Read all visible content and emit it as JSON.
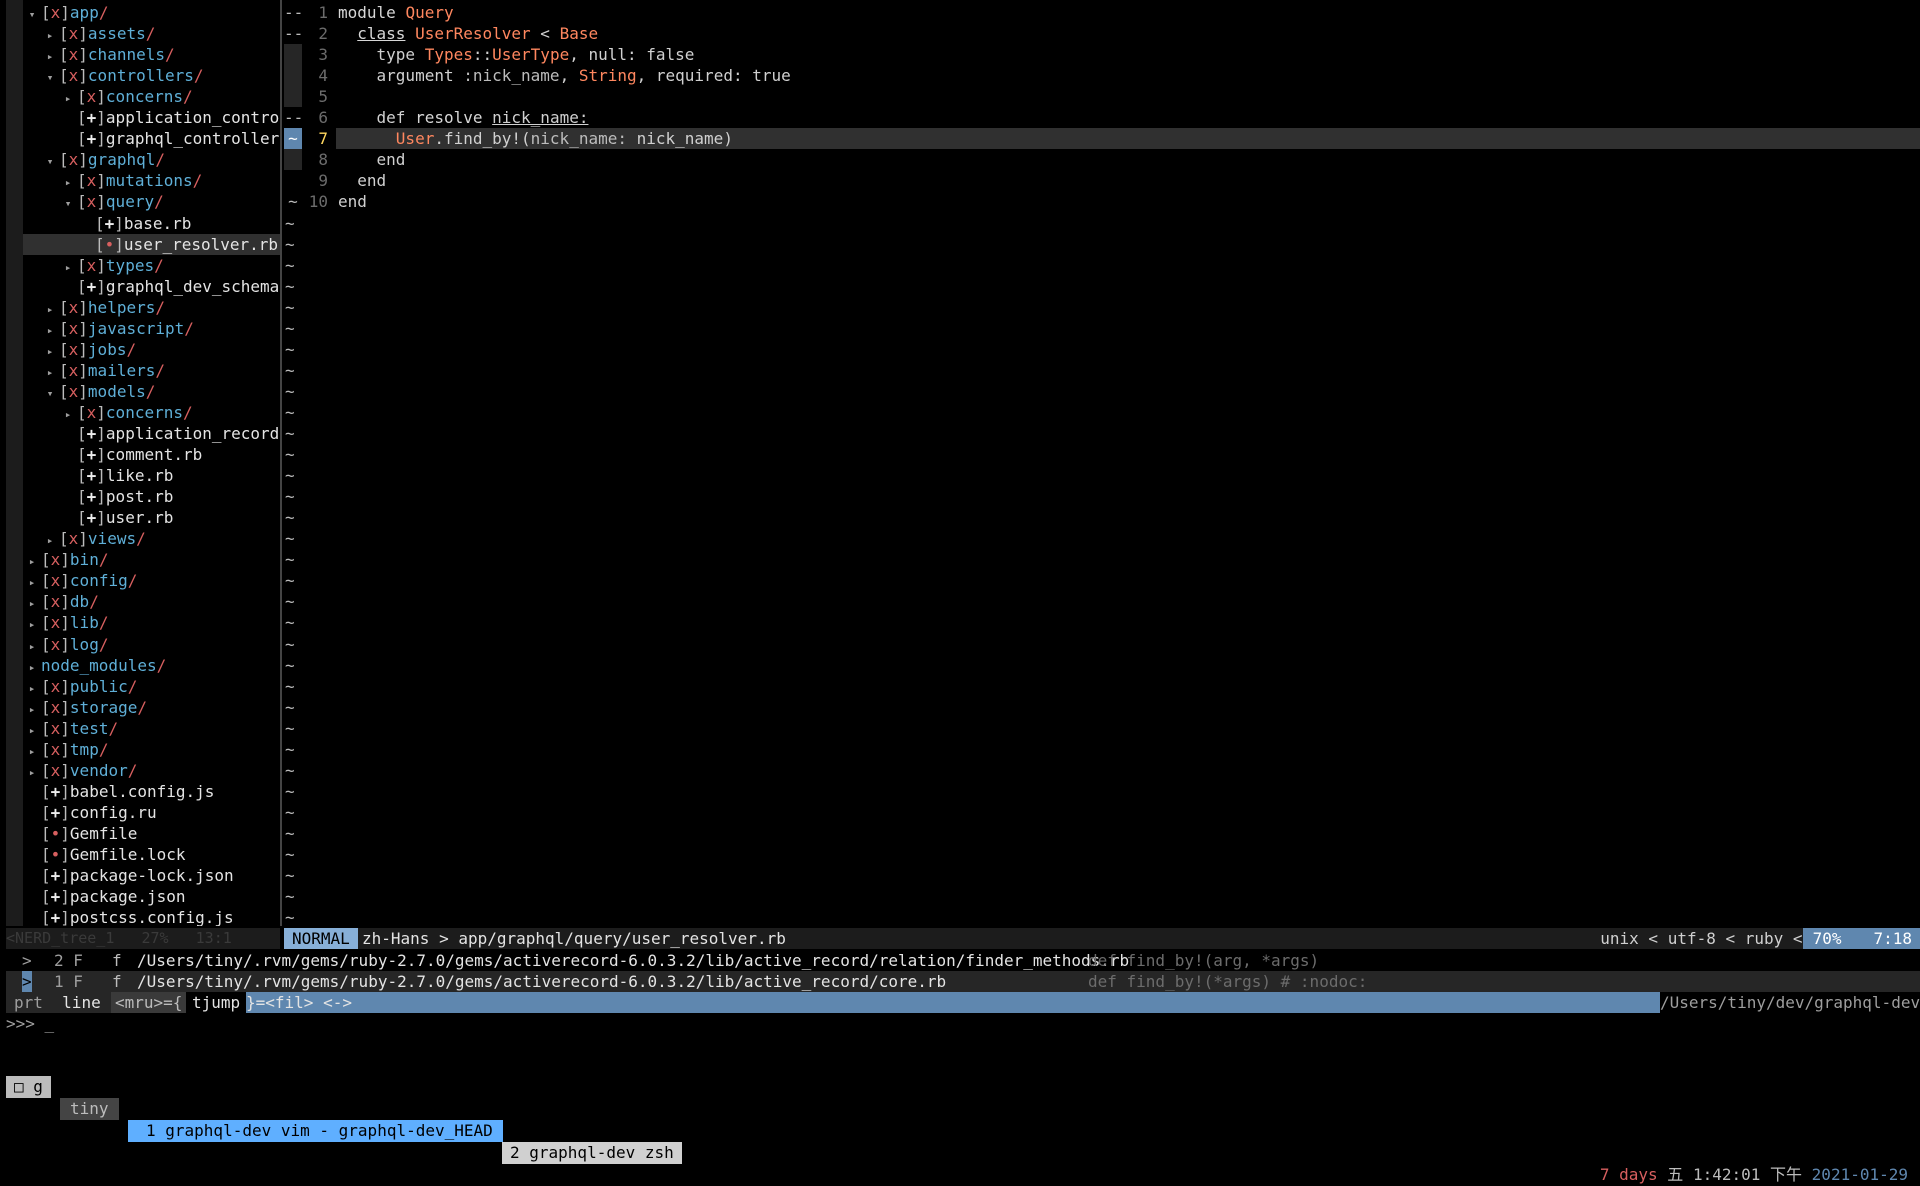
{
  "tree": [
    {
      "depth": 0,
      "arrow": "▾",
      "kind": "dir",
      "mark": "x",
      "name": "app"
    },
    {
      "depth": 1,
      "arrow": "▸",
      "kind": "dir",
      "mark": "x",
      "name": "assets"
    },
    {
      "depth": 1,
      "arrow": "▸",
      "kind": "dir",
      "mark": "x",
      "name": "channels"
    },
    {
      "depth": 1,
      "arrow": "▾",
      "kind": "dir",
      "mark": "x",
      "name": "controllers"
    },
    {
      "depth": 2,
      "arrow": "▸",
      "kind": "dir",
      "mark": "x",
      "name": "concerns"
    },
    {
      "depth": 2,
      "arrow": "",
      "kind": "file",
      "mark": "+",
      "name": "application_control"
    },
    {
      "depth": 2,
      "arrow": "",
      "kind": "file",
      "mark": "+",
      "name": "graphql_controller."
    },
    {
      "depth": 1,
      "arrow": "▾",
      "kind": "dir",
      "mark": "x",
      "name": "graphql"
    },
    {
      "depth": 2,
      "arrow": "▸",
      "kind": "dir",
      "mark": "x",
      "name": "mutations"
    },
    {
      "depth": 2,
      "arrow": "▾",
      "kind": "dir",
      "mark": "x",
      "name": "query"
    },
    {
      "depth": 3,
      "arrow": "",
      "kind": "file",
      "mark": "+",
      "name": "base.rb"
    },
    {
      "depth": 3,
      "arrow": "",
      "kind": "file",
      "mark": "•",
      "name": "user_resolver.rb",
      "selected": true
    },
    {
      "depth": 2,
      "arrow": "▸",
      "kind": "dir",
      "mark": "x",
      "name": "types"
    },
    {
      "depth": 2,
      "arrow": "",
      "kind": "file",
      "mark": "+",
      "name": "graphql_dev_schema."
    },
    {
      "depth": 1,
      "arrow": "▸",
      "kind": "dir",
      "mark": "x",
      "name": "helpers"
    },
    {
      "depth": 1,
      "arrow": "▸",
      "kind": "dir",
      "mark": "x",
      "name": "javascript"
    },
    {
      "depth": 1,
      "arrow": "▸",
      "kind": "dir",
      "mark": "x",
      "name": "jobs"
    },
    {
      "depth": 1,
      "arrow": "▸",
      "kind": "dir",
      "mark": "x",
      "name": "mailers"
    },
    {
      "depth": 1,
      "arrow": "▾",
      "kind": "dir",
      "mark": "x",
      "name": "models"
    },
    {
      "depth": 2,
      "arrow": "▸",
      "kind": "dir",
      "mark": "x",
      "name": "concerns"
    },
    {
      "depth": 2,
      "arrow": "",
      "kind": "file",
      "mark": "+",
      "name": "application_record."
    },
    {
      "depth": 2,
      "arrow": "",
      "kind": "file",
      "mark": "+",
      "name": "comment.rb"
    },
    {
      "depth": 2,
      "arrow": "",
      "kind": "file",
      "mark": "+",
      "name": "like.rb"
    },
    {
      "depth": 2,
      "arrow": "",
      "kind": "file",
      "mark": "+",
      "name": "post.rb"
    },
    {
      "depth": 2,
      "arrow": "",
      "kind": "file",
      "mark": "+",
      "name": "user.rb"
    },
    {
      "depth": 1,
      "arrow": "▸",
      "kind": "dir",
      "mark": "x",
      "name": "views"
    },
    {
      "depth": 0,
      "arrow": "▸",
      "kind": "dir",
      "mark": "x",
      "name": "bin"
    },
    {
      "depth": 0,
      "arrow": "▸",
      "kind": "dir",
      "mark": "x",
      "name": "config"
    },
    {
      "depth": 0,
      "arrow": "▸",
      "kind": "dir",
      "mark": "x",
      "name": "db"
    },
    {
      "depth": 0,
      "arrow": "▸",
      "kind": "dir",
      "mark": "x",
      "name": "lib"
    },
    {
      "depth": 0,
      "arrow": "▸",
      "kind": "dir",
      "mark": "x",
      "name": "log"
    },
    {
      "depth": 0,
      "arrow": "▸",
      "kind": "dir",
      "mark": "",
      "name": "node_modules"
    },
    {
      "depth": 0,
      "arrow": "▸",
      "kind": "dir",
      "mark": "x",
      "name": "public"
    },
    {
      "depth": 0,
      "arrow": "▸",
      "kind": "dir",
      "mark": "x",
      "name": "storage"
    },
    {
      "depth": 0,
      "arrow": "▸",
      "kind": "dir",
      "mark": "x",
      "name": "test"
    },
    {
      "depth": 0,
      "arrow": "▸",
      "kind": "dir",
      "mark": "x",
      "name": "tmp"
    },
    {
      "depth": 0,
      "arrow": "▸",
      "kind": "dir",
      "mark": "x",
      "name": "vendor"
    },
    {
      "depth": 0,
      "arrow": "",
      "kind": "file",
      "mark": "+",
      "name": "babel.config.js"
    },
    {
      "depth": 0,
      "arrow": "",
      "kind": "file",
      "mark": "+",
      "name": "config.ru"
    },
    {
      "depth": 0,
      "arrow": "",
      "kind": "file",
      "mark": "•",
      "name": "Gemfile"
    },
    {
      "depth": 0,
      "arrow": "",
      "kind": "file",
      "mark": "•",
      "name": "Gemfile.lock"
    },
    {
      "depth": 0,
      "arrow": "",
      "kind": "file",
      "mark": "+",
      "name": "package-lock.json"
    },
    {
      "depth": 0,
      "arrow": "",
      "kind": "file",
      "mark": "+",
      "name": "package.json"
    },
    {
      "depth": 0,
      "arrow": "",
      "kind": "file",
      "mark": "+",
      "name": "postcss.config.js"
    }
  ],
  "signs": [
    "--",
    "--",
    "",
    "",
    "",
    "--",
    "~",
    "",
    "",
    "~"
  ],
  "code": [
    [
      {
        "t": "module ",
        "c": "kw ul-first"
      },
      {
        "t": "Query",
        "c": "const"
      }
    ],
    [
      {
        "t": "  "
      },
      {
        "t": "class",
        "c": "kw ul"
      },
      {
        "t": " "
      },
      {
        "t": "UserResolver",
        "c": "const"
      },
      {
        "t": " < "
      },
      {
        "t": "Base",
        "c": "const"
      }
    ],
    [
      {
        "t": "    type "
      },
      {
        "t": "Types",
        "c": "const"
      },
      {
        "t": "::"
      },
      {
        "t": "UserType",
        "c": "const"
      },
      {
        "t": ", null: false"
      }
    ],
    [
      {
        "t": "    argument "
      },
      {
        "t": ":nick_name",
        "c": "sym"
      },
      {
        "t": ", "
      },
      {
        "t": "String",
        "c": "const"
      },
      {
        "t": ", required: true"
      }
    ],
    [
      {
        "t": ""
      }
    ],
    [
      {
        "t": "    def "
      },
      {
        "t": "resolve",
        "c": "kw"
      },
      {
        "t": " "
      },
      {
        "t": "nick_name:",
        "c": "ul"
      }
    ],
    [
      {
        "t": "      "
      },
      {
        "t": "User",
        "c": "const"
      },
      {
        "t": ".find_by!("
      },
      {
        "t": "nick_name:",
        "c": "sym"
      },
      {
        "t": " nick_name)"
      }
    ],
    [
      {
        "t": "    end"
      }
    ],
    [
      {
        "t": "  end"
      }
    ],
    [
      {
        "t": "end"
      }
    ]
  ],
  "nerd_status": "<NERD_tree_1   27%   13:1",
  "status": {
    "mode": "NORMAL",
    "path": "zh-Hans > app/graphql/query/user_resolver.rb",
    "info": "unix < utf-8 < ruby <",
    "percent": "70%",
    "position": "7:18"
  },
  "ctrlp": [
    {
      "arrow": ">",
      "num": "2 F",
      "f": "f",
      "path": "/Users/tiny/.rvm/gems/ruby-2.7.0/gems/activerecord-6.0.3.2/lib/active_record/relation/finder_methods.rb",
      "def": "def find_by!(arg, *args)"
    },
    {
      "arrow": ">",
      "num": "1 F",
      "f": "f",
      "path": "/Users/tiny/.rvm/gems/ruby-2.7.0/gems/activerecord-6.0.3.2/lib/active_record/core.rb",
      "def": "def find_by!(*args) # :nodoc:",
      "selected": true
    }
  ],
  "prompt": {
    "prt": "prt",
    "line": "line",
    "mru": "<mru>={",
    "tjump": "tjump",
    "fil": "}=<fil> <->",
    "cwd": "/Users/tiny/dev/graphql-dev",
    "cmd": ">>> _"
  },
  "tmux": {
    "session": "□ g",
    "user": "tiny",
    "window1": "1 graphql-dev vim - graphql-dev_HEAD",
    "window2": "2 graphql-dev zsh",
    "days": "7 days",
    "weekday": "五",
    "time": "1:42:01 下午",
    "date": "2021-01-29"
  }
}
